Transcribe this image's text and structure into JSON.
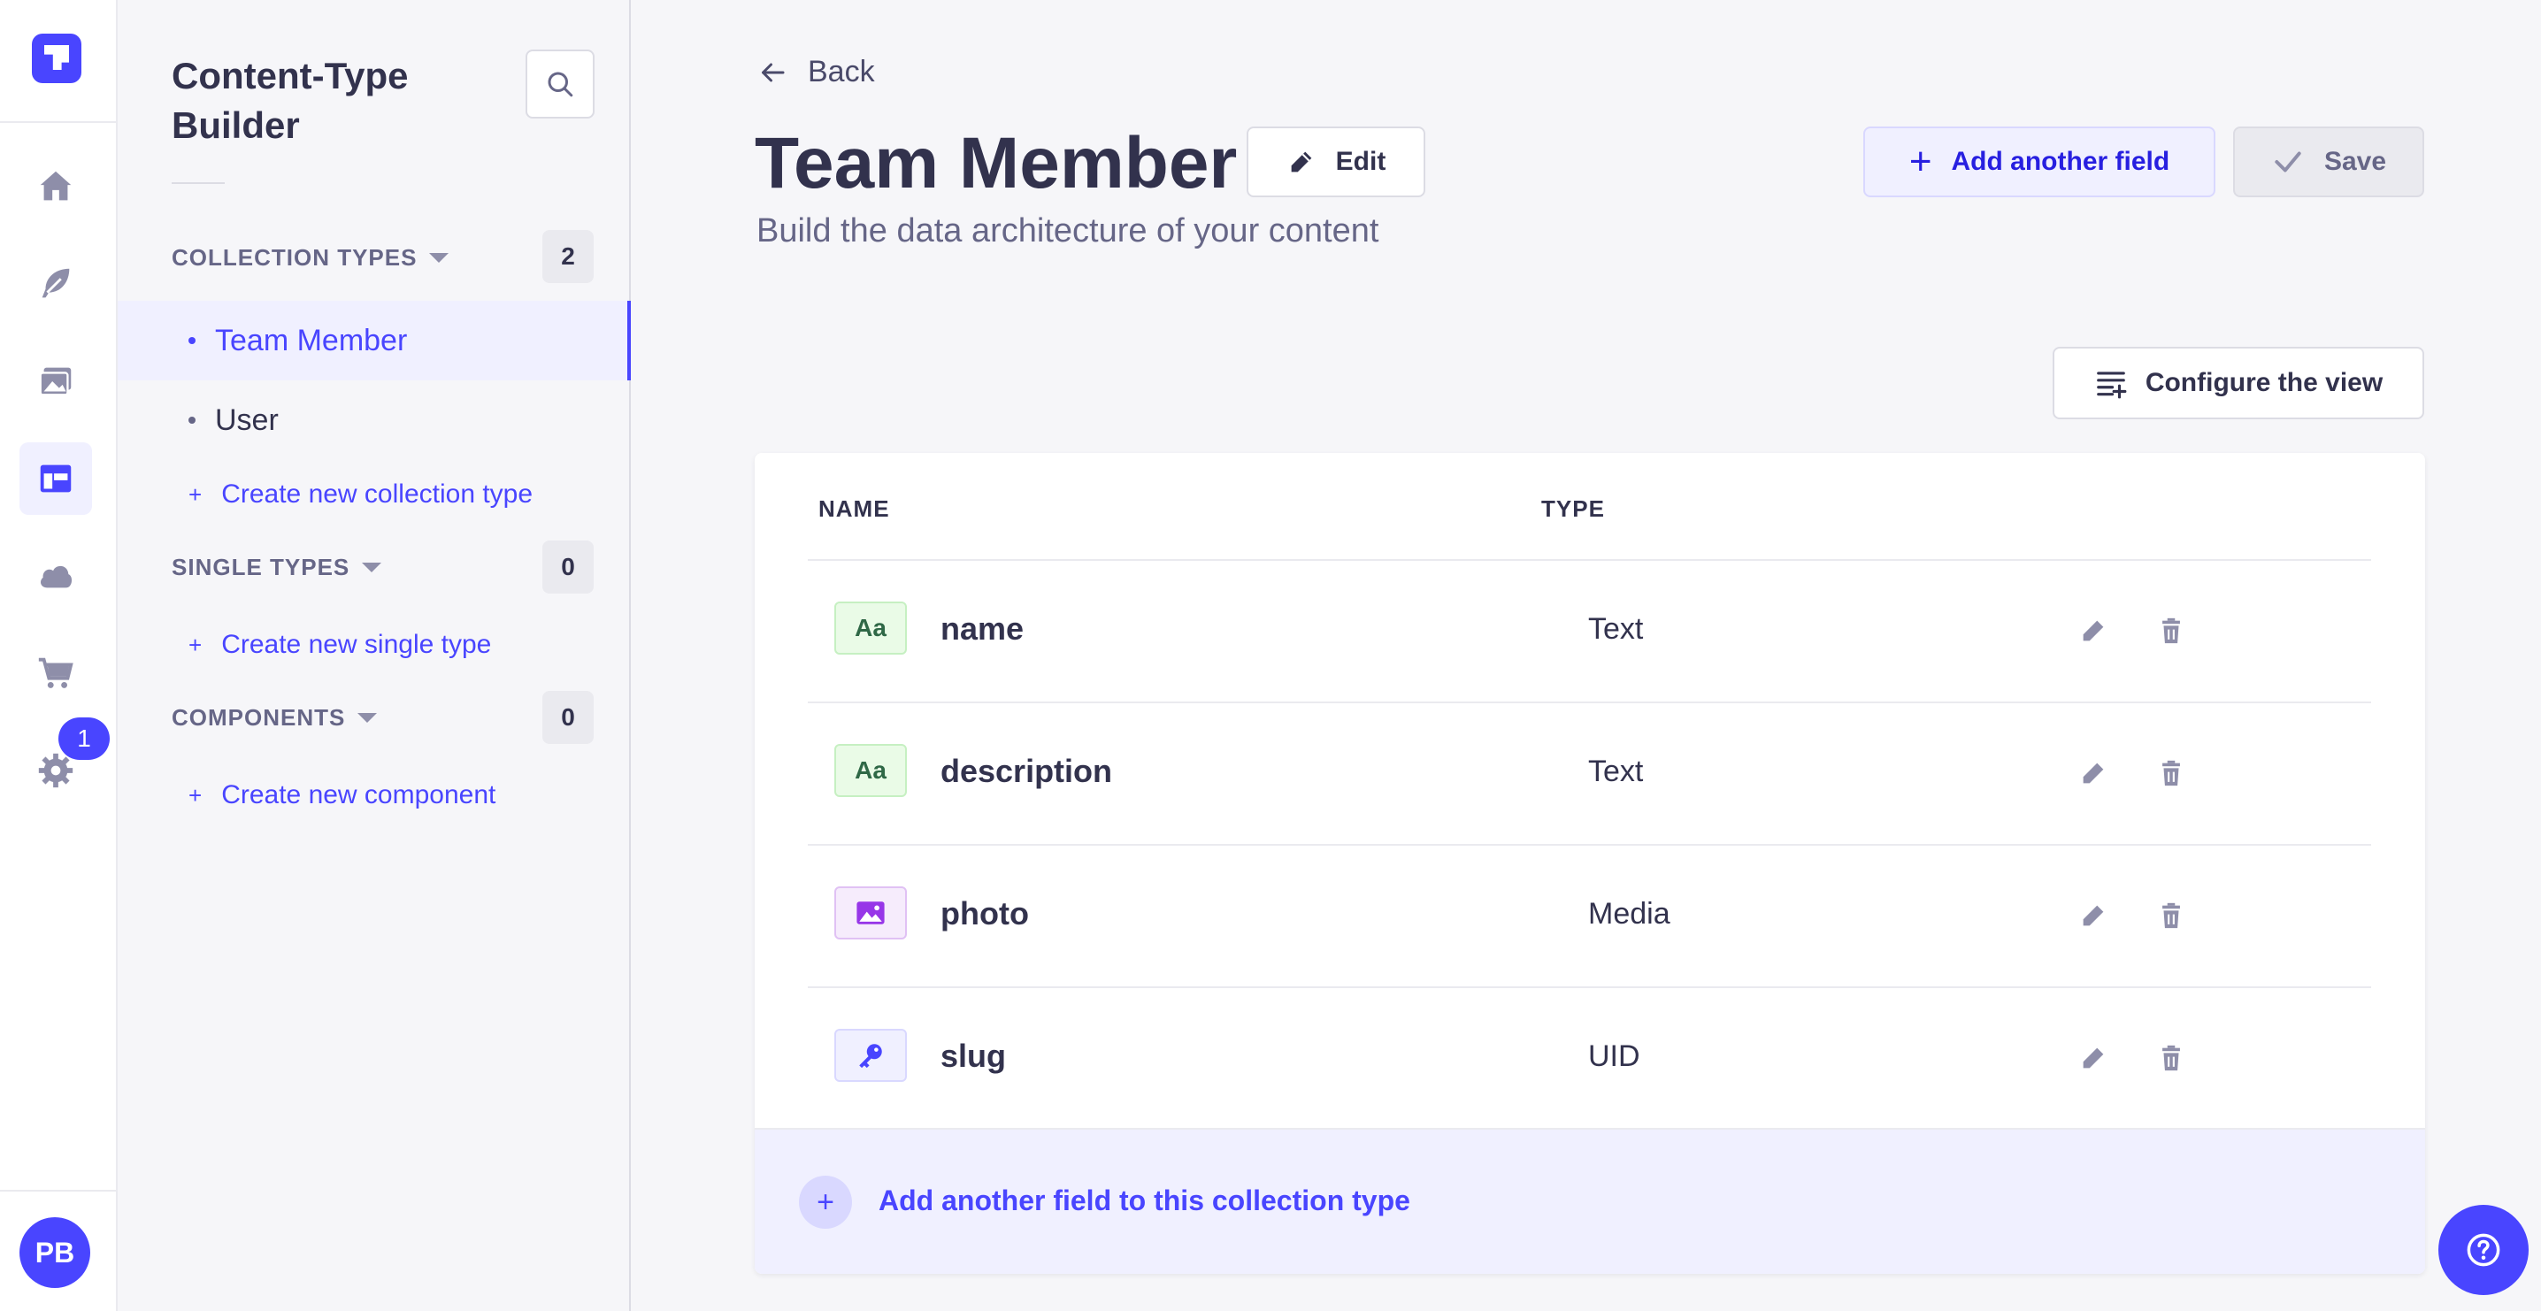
{
  "rail": {
    "avatar_initials": "PB",
    "settings_badge": "1",
    "items": [
      "home-icon",
      "feather-icon",
      "media-library-icon",
      "layout-icon",
      "cloud-icon",
      "cart-icon",
      "gear-icon"
    ]
  },
  "subnav": {
    "title": "Content-Type Builder",
    "sections": {
      "collection": {
        "label": "COLLECTION TYPES",
        "count": "2",
        "items": [
          "Team Member",
          "User"
        ],
        "create": "Create new collection type"
      },
      "single": {
        "label": "SINGLE TYPES",
        "count": "0",
        "create": "Create new single type"
      },
      "components": {
        "label": "COMPONENTS",
        "count": "0",
        "create": "Create new component"
      }
    }
  },
  "header": {
    "back": "Back",
    "title": "Team Member",
    "edit": "Edit",
    "subtitle": "Build the data architecture of your content",
    "add_field": "Add another field",
    "save": "Save",
    "configure": "Configure the view"
  },
  "table": {
    "columns": [
      "NAME",
      "TYPE"
    ],
    "rows": [
      {
        "name": "name",
        "type": "Text",
        "icon": "Aa"
      },
      {
        "name": "description",
        "type": "Text",
        "icon": "Aa"
      },
      {
        "name": "photo",
        "type": "Media",
        "icon": "image-icon"
      },
      {
        "name": "slug",
        "type": "UID",
        "icon": "key-icon"
      }
    ],
    "footer": "Add another field to this collection type"
  },
  "colors": {
    "primary": "#4945ff",
    "background": "#f6f6f9",
    "text": "#32324d"
  }
}
